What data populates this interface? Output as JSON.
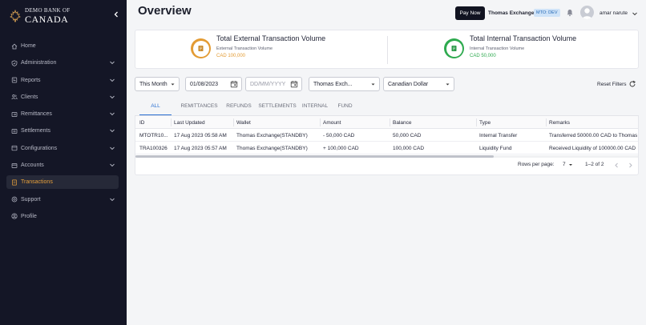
{
  "brand": {
    "line1": "DEMO BANK OF",
    "line2": "CANADA"
  },
  "sidebar": {
    "items": [
      {
        "label": "Home",
        "icon": "home-icon",
        "chevron": false,
        "active": false
      },
      {
        "label": "Administration",
        "icon": "shield-icon",
        "chevron": true,
        "active": false
      },
      {
        "label": "Reports",
        "icon": "report-icon",
        "chevron": true,
        "active": false
      },
      {
        "label": "Clients",
        "icon": "users-icon",
        "chevron": true,
        "active": false
      },
      {
        "label": "Remittances",
        "icon": "remittance-icon",
        "chevron": true,
        "active": false
      },
      {
        "label": "Settlements",
        "icon": "settlement-icon",
        "chevron": true,
        "active": false
      },
      {
        "label": "Configurations",
        "icon": "config-icon",
        "chevron": true,
        "active": false
      },
      {
        "label": "Accounts",
        "icon": "accounts-icon",
        "chevron": true,
        "active": false
      },
      {
        "label": "Transactions",
        "icon": "transactions-icon",
        "chevron": false,
        "active": true
      },
      {
        "label": "Support",
        "icon": "support-icon",
        "chevron": true,
        "active": false
      },
      {
        "label": "Profile",
        "icon": "profile-icon",
        "chevron": false,
        "active": false
      }
    ]
  },
  "header": {
    "title": "Overview",
    "pay_now": "Pay Now",
    "org_name": "Thomas Exchange",
    "env_badge": "MTO: DEV",
    "user_name": "amar narute"
  },
  "summary": {
    "external": {
      "title": "Total External Transaction Volume",
      "subtitle": "External Transaction Volume",
      "value": "CAD 100,000",
      "color": "#e39b33"
    },
    "internal": {
      "title": "Total Internal Transaction Volume",
      "subtitle": "Internal Transaction Volume",
      "value": "CAD 50,000",
      "color": "#2eaa4f"
    }
  },
  "filters": {
    "period": "This Month",
    "from_date": "01/08/2023",
    "to_date_placeholder": "DD/MM/YYYY",
    "wallet": "Thomas Exch...",
    "currency": "Canadian Dollar",
    "reset": "Reset Filters"
  },
  "tabs": [
    "ALL",
    "REMITTANCES",
    "REFUNDS",
    "SETTLEMENTS",
    "INTERNAL",
    "FUND"
  ],
  "active_tab": "ALL",
  "table": {
    "columns": [
      "ID",
      "Last Updated",
      "Wallet",
      "Amount",
      "Balance",
      "Type",
      "Remarks"
    ],
    "rows": [
      [
        "MTOTR10...",
        "17 Aug 2023 05:58 AM",
        "Thomas Exchange(STANDBY)",
        "- 50,000 CAD",
        "50,000 CAD",
        "Internal Transfer",
        "Transferred 50000.00 CAD to Thomas"
      ],
      [
        "TRA100326",
        "17 Aug 2023 05:57 AM",
        "Thomas Exchange(STANDBY)",
        "+ 100,000 CAD",
        "100,000 CAD",
        "Liquidity Fund",
        "Received Liquidity of 100000.00 CAD"
      ]
    ]
  },
  "pagination": {
    "rows_per_page_label": "Rows per page:",
    "rows_per_page": "7",
    "range": "1–2 of 2"
  }
}
